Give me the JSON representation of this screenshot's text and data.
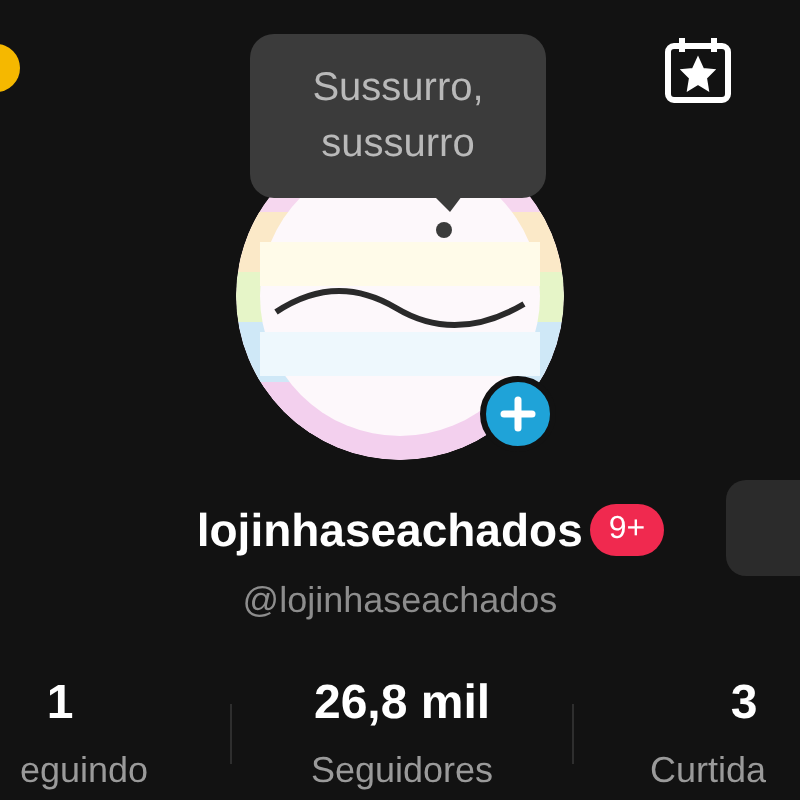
{
  "tooltip": {
    "text": "Sussurro, sussurro"
  },
  "profile": {
    "name": "lojinhaseachados",
    "notification_badge": "9+",
    "handle": "@lojinhaseachados"
  },
  "stats": [
    {
      "value": "1",
      "label": "eguindo"
    },
    {
      "value": "26,8 mil",
      "label": "Seguidores"
    },
    {
      "value": "3",
      "label": "Curtida"
    }
  ]
}
